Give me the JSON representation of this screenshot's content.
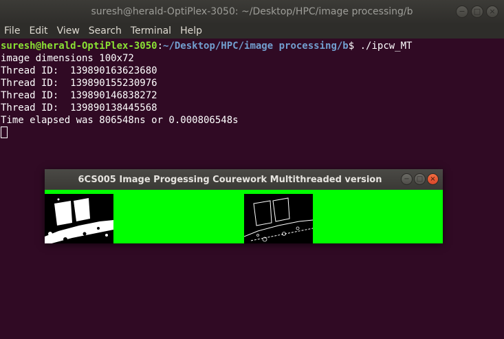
{
  "terminal_window": {
    "title": "suresh@herald-OptiPlex-3050: ~/Desktop/HPC/image processing/b",
    "controls": {
      "minimize": "−",
      "maximize": "□",
      "close": "×"
    },
    "menu": [
      "File",
      "Edit",
      "View",
      "Search",
      "Terminal",
      "Help"
    ],
    "prompt": {
      "user_host": "suresh@herald-OptiPlex-3050",
      "sep": ":",
      "path": "~/Desktop/HPC/image processing/b",
      "symbol": "$",
      "command": " ./ipcw_MT"
    },
    "output_lines": [
      "image dimensions 100x72",
      "Thread ID:  139890163623680",
      "Thread ID:  139890155230976",
      "Thread ID:  139890146838272",
      "Thread ID:  139890138445568",
      "Time elapsed was 806548ns or 0.000806548s"
    ]
  },
  "image_window": {
    "title": "6CS005 Image Progessing Courework Multithreaded version",
    "controls": {
      "minimize": "−",
      "maximize": "□",
      "close": "×"
    },
    "background_color": "#00ff00"
  },
  "colors": {
    "terminal_bg": "#300a24",
    "prompt_user": "#8ae234",
    "prompt_path": "#729fcf"
  }
}
